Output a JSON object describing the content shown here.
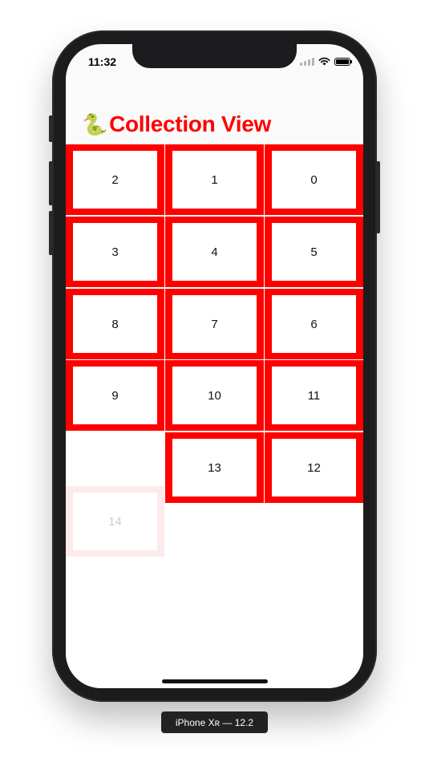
{
  "status_bar": {
    "time": "11:32"
  },
  "nav": {
    "emoji": "🐍",
    "title": "Collection View"
  },
  "title_color": "#ff0000",
  "cell_color": "#ff0000",
  "cells": [
    "2",
    "1",
    "0",
    "3",
    "4",
    "5",
    "8",
    "7",
    "6",
    "9",
    "10",
    "11",
    "13",
    "12"
  ],
  "dragging_cell": "14",
  "device_label": "iPhone Xʀ — 12.2"
}
